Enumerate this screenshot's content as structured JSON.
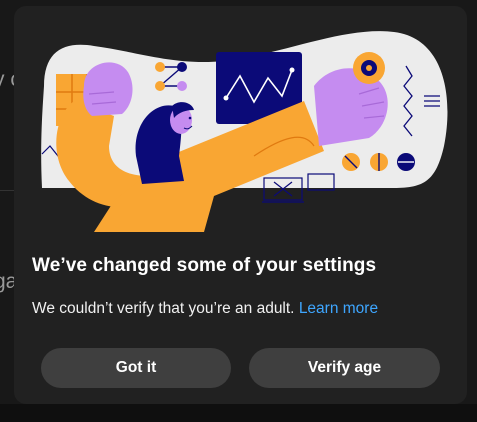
{
  "background": {
    "partial_text_top": "y c",
    "partial_text_mid": "ga"
  },
  "dialog": {
    "illustration_icon": "adult-verification-illustration",
    "title": "We’ve changed some of your settings",
    "body_text": "We couldn’t verify that you’re an adult.",
    "learn_more_label": "Learn more",
    "buttons": {
      "got_it": "Got it",
      "verify_age": "Verify age"
    }
  },
  "colors": {
    "dialog_bg": "#212121",
    "button_bg": "#3f3f3f",
    "link": "#3ea6ff",
    "illustration_orange": "#f9a633",
    "illustration_purple": "#c58cf0",
    "illustration_navy": "#0b0a78"
  }
}
